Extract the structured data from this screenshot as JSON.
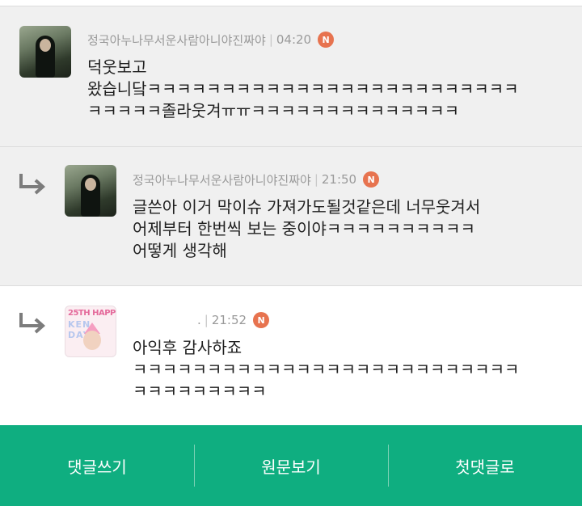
{
  "comments": [
    {
      "author": "정국아누나무서운사람아니야진짜야",
      "time": "04:20",
      "badge": "N",
      "lines": [
        "덕웃보고",
        "왔습니닼ㅋㅋㅋㅋㅋㅋㅋㅋㅋㅋㅋㅋㅋㅋㅋㅋㅋㅋㅋㅋㅋㅋㅋㅋㅋ",
        "ㅋㅋㅋㅋㅋ졸라웃겨ㅠㅠㅋㅋㅋㅋㅋㅋㅋㅋㅋㅋㅋㅋㅋㅋ"
      ],
      "is_reply": false
    },
    {
      "author": "정국아누나무서운사람아니야진짜야",
      "time": "21:50",
      "badge": "N",
      "lines": [
        "글쓴아 이거 막이슈 가져가도될것같은데 너무웃겨서",
        "어제부터 한번씩 보는 중이야ㅋㅋㅋㅋㅋㅋㅋㅋㅋㅋ",
        "어떻게 생각해"
      ],
      "is_reply": true
    },
    {
      "author_prefix": ".",
      "time": "21:52",
      "badge": "N",
      "avatar_text_top": "25TH HAPP",
      "avatar_text_bottom": "KEN DAY",
      "lines": [
        "아익후 감사하죠",
        "ㅋㅋㅋㅋㅋㅋㅋㅋㅋㅋㅋㅋㅋㅋㅋㅋㅋㅋㅋㅋㅋㅋㅋㅋㅋㅋ",
        "ㅋㅋㅋㅋㅋㅋㅋㅋㅋ"
      ],
      "is_reply": true
    }
  ],
  "bottom_bar": {
    "write_comment": "댓글쓰기",
    "view_original": "원문보기",
    "first_comment": "첫댓글로"
  },
  "colors": {
    "accent_green": "#0fae80",
    "badge_orange": "#e7734f",
    "meta_gray": "#9a9a9a"
  },
  "icons": [
    "reply-arrow-icon",
    "new-badge-icon"
  ]
}
